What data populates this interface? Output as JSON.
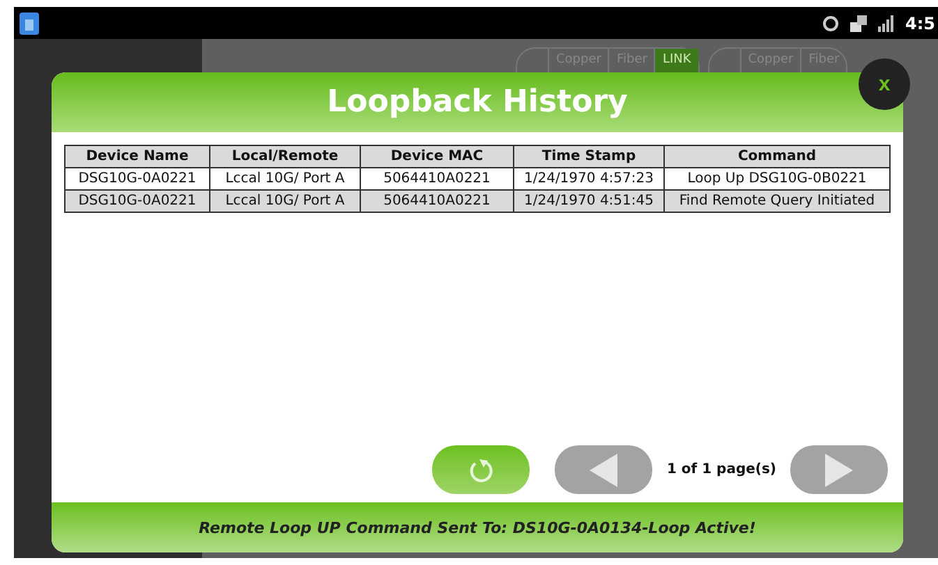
{
  "status_bar": {
    "time": "4:5"
  },
  "background": {
    "port_groups": [
      {
        "tabs": [
          {
            "label": "Copper",
            "selected": false
          },
          {
            "label": "Fiber",
            "selected": false
          },
          {
            "label": "LINK",
            "selected": true
          }
        ]
      },
      {
        "tabs": [
          {
            "label": "Copper",
            "selected": false
          },
          {
            "label": "Fiber",
            "selected": false
          }
        ]
      }
    ]
  },
  "dialog": {
    "title": "Loopback History",
    "close": "x",
    "table": {
      "columns": [
        "Device Name",
        "Local/Remote",
        "Device MAC",
        "Time Stamp",
        "Command"
      ],
      "rows": [
        [
          "DSG10G-0A0221",
          "Lccal 10G/ Port A",
          "5064410A0221",
          "1/24/1970 4:57:23",
          "Loop Up DSG10G-0B0221"
        ],
        [
          "DSG10G-0A0221",
          "Lccal 10G/ Port A",
          "5064410A0221",
          "1/24/1970 4:51:45",
          "Find Remote Query Initiated"
        ]
      ]
    },
    "pager": {
      "text": "1 of 1 page(s)"
    },
    "message": "Remote Loop UP Command Sent To: DS10G-0A0134-Loop Active!"
  }
}
